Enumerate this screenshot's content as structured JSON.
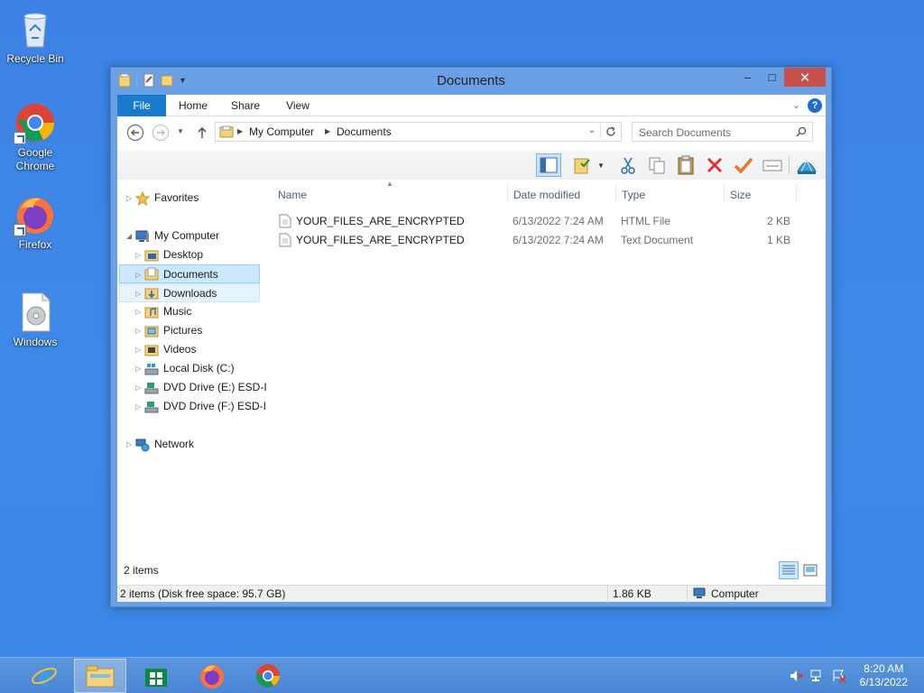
{
  "desktop": {
    "icons": [
      {
        "label": "Recycle Bin"
      },
      {
        "label": "Google Chrome"
      },
      {
        "label": "Firefox"
      },
      {
        "label": "Windows"
      }
    ]
  },
  "window": {
    "title": "Documents",
    "ribbon_tabs": {
      "file": "File",
      "home": "Home",
      "share": "Share",
      "view": "View"
    },
    "address": {
      "seg1": "My Computer",
      "seg2": "Documents"
    },
    "search_placeholder": "Search Documents",
    "navpane": {
      "favorites": "Favorites",
      "my_computer": "My Computer",
      "desktop": "Desktop",
      "documents": "Documents",
      "downloads": "Downloads",
      "music": "Music",
      "pictures": "Pictures",
      "videos": "Videos",
      "local_disk": "Local Disk (C:)",
      "dvd_e": "DVD Drive (E:) ESD-IS",
      "dvd_f": "DVD Drive (F:) ESD-IS",
      "network": "Network"
    },
    "columns": {
      "name": "Name",
      "date": "Date modified",
      "type": "Type",
      "size": "Size"
    },
    "files": [
      {
        "name": "YOUR_FILES_ARE_ENCRYPTED",
        "date": "6/13/2022 7:24 AM",
        "type": "HTML File",
        "size": "2 KB"
      },
      {
        "name": "YOUR_FILES_ARE_ENCRYPTED",
        "date": "6/13/2022 7:24 AM",
        "type": "Text Document",
        "size": "1 KB"
      }
    ],
    "items_count": "2 items",
    "status": {
      "left": "2 items (Disk free space: 95.7 GB)",
      "mid": "1.86 KB",
      "right": "Computer"
    }
  },
  "taskbar": {
    "time": "8:20 AM",
    "date": "6/13/2022"
  }
}
